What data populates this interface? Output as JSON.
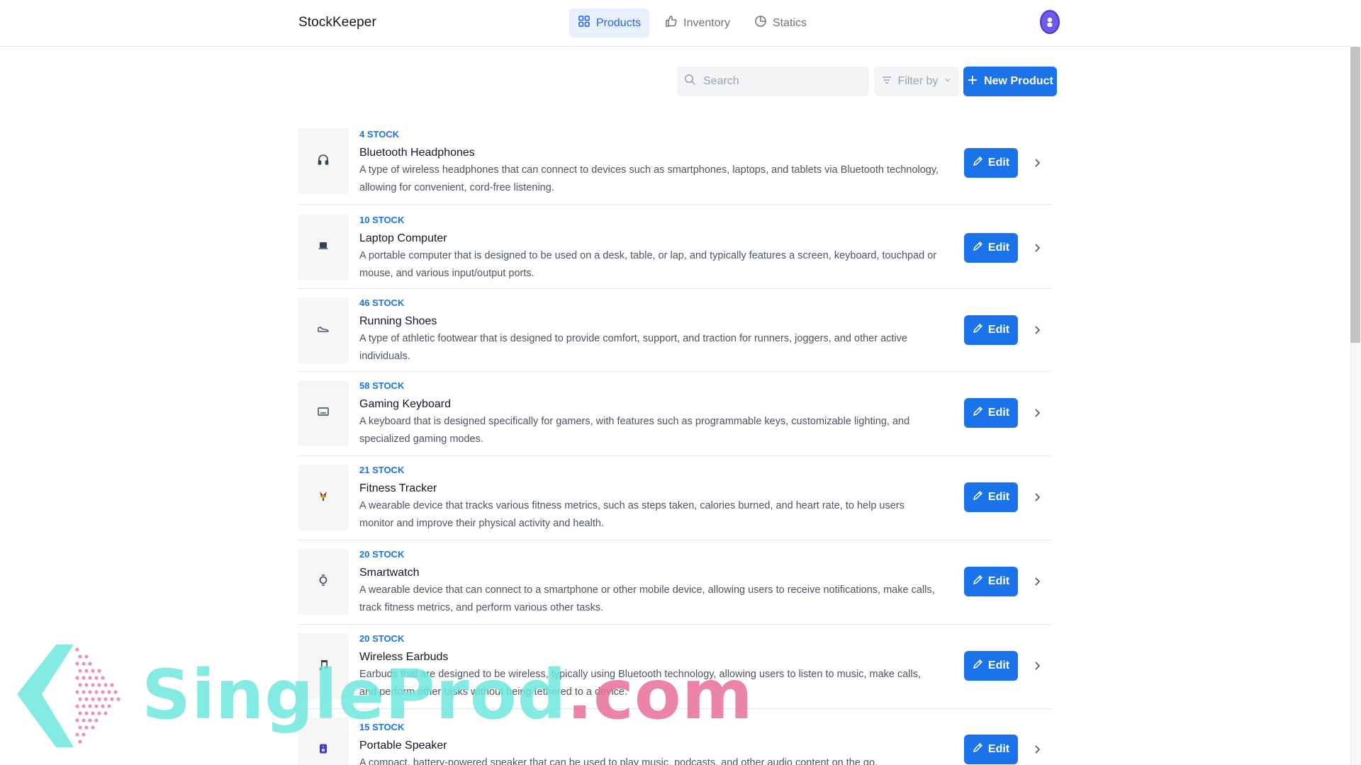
{
  "app": {
    "brand": "StockKeeper"
  },
  "nav": [
    {
      "label": "Products",
      "icon": "grid-icon",
      "active": true
    },
    {
      "label": "Inventory",
      "icon": "thumbs-up-icon",
      "active": false
    },
    {
      "label": "Statics",
      "icon": "pie-chart-icon",
      "active": false
    }
  ],
  "toolbar": {
    "search_placeholder": "Search",
    "filter_label": "Filter by",
    "new_label": "New Product"
  },
  "products": [
    {
      "stock": "4 STOCK",
      "name": "Bluetooth Headphones",
      "desc": "A type of wireless headphones that can connect to devices such as smartphones, laptops, and tablets via Bluetooth technology, allowing for convenient, cord-free listening.",
      "icon": "headphones-icon",
      "edit": "Edit"
    },
    {
      "stock": "10 STOCK",
      "name": "Laptop Computer",
      "desc": "A portable computer that is designed to be used on a desk, table, or lap, and typically features a screen, keyboard, touchpad or mouse, and various input/output ports.",
      "icon": "laptop-icon",
      "edit": "Edit"
    },
    {
      "stock": "46 STOCK",
      "name": "Running Shoes",
      "desc": "A type of athletic footwear that is designed to provide comfort, support, and traction for runners, joggers, and other active individuals.",
      "icon": "shoe-icon",
      "edit": "Edit"
    },
    {
      "stock": "58 STOCK",
      "name": "Gaming Keyboard",
      "desc": "A keyboard that is designed specifically for gamers, with features such as programmable keys, customizable lighting, and specialized gaming modes.",
      "icon": "keyboard-icon",
      "edit": "Edit"
    },
    {
      "stock": "21 STOCK",
      "name": "Fitness Tracker",
      "desc": "A wearable device that tracks various fitness metrics, such as steps taken, calories burned, and heart rate, to help users monitor and improve their physical activity and health.",
      "icon": "fitness-tracker-icon",
      "edit": "Edit"
    },
    {
      "stock": "20 STOCK",
      "name": "Smartwatch",
      "desc": "A wearable device that can connect to a smartphone or other mobile device, allowing users to receive notifications, make calls, track fitness metrics, and perform various other tasks.",
      "icon": "watch-icon",
      "edit": "Edit"
    },
    {
      "stock": "20 STOCK",
      "name": "Wireless Earbuds",
      "desc": "Earbuds that are designed to be wireless, typically using Bluetooth technology, allowing users to listen to music, make calls, and perform other tasks without being tethered to a device.",
      "icon": "music-note-icon",
      "edit": "Edit"
    },
    {
      "stock": "15 STOCK",
      "name": "Portable Speaker",
      "desc": "A compact, battery-powered speaker that can be used to play music, podcasts, and other audio content on the go.",
      "icon": "speaker-icon",
      "edit": "Edit"
    }
  ],
  "watermark": {
    "text": "SingleProd",
    "suffix": ".com"
  },
  "colors": {
    "accent": "#1a73e8",
    "nav_active_bg": "#e8f0fe",
    "watermark_main": "#6ee8dd",
    "watermark_suffix": "#e86e96"
  }
}
